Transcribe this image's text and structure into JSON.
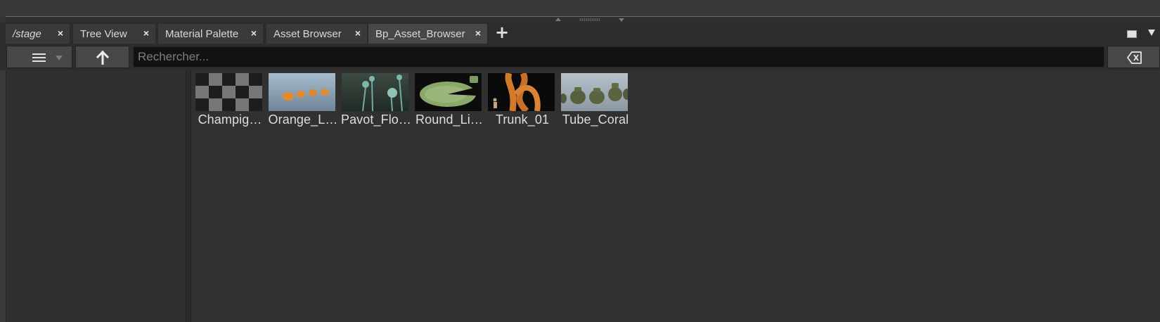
{
  "tabs": [
    {
      "label": "/stage",
      "italic": true,
      "active": false
    },
    {
      "label": "Tree View",
      "italic": false,
      "active": false
    },
    {
      "label": "Material Palette",
      "italic": false,
      "active": false
    },
    {
      "label": "Asset Browser",
      "italic": false,
      "active": false
    },
    {
      "label": "Bp_Asset_Browser",
      "italic": false,
      "active": true
    }
  ],
  "tab_close_glyph": "×",
  "add_tab_glyph": "+",
  "toolbar": {
    "menu_icon": "hamburger-icon",
    "up_icon": "arrow-up-icon",
    "clear_icon": "backspace-icon"
  },
  "search": {
    "placeholder": "Rechercher...",
    "value": ""
  },
  "assets": [
    {
      "label": "Champig…",
      "thumbnail": "checkerboard"
    },
    {
      "label": "Orange_L…",
      "thumbnail": "orange-pieces"
    },
    {
      "label": "Pavot_Flo…",
      "thumbnail": "poppy-pods"
    },
    {
      "label": "Round_Li…",
      "thumbnail": "lily-pad"
    },
    {
      "label": "Trunk_01",
      "thumbnail": "orange-trunk"
    },
    {
      "label": "Tube_Coral",
      "thumbnail": "coral-pots"
    }
  ],
  "colors": {
    "background": "#333333",
    "panel": "#313131",
    "active_tab": "#474747",
    "search_field": "#121212"
  }
}
